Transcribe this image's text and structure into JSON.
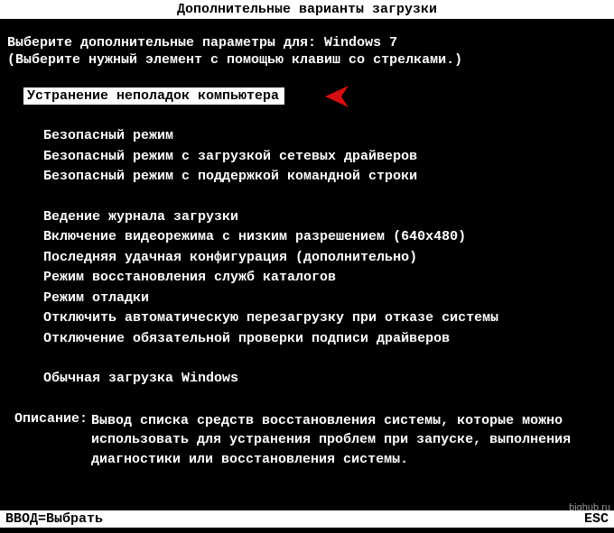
{
  "title": "Дополнительные варианты загрузки",
  "prompt": "Выберите дополнительные параметры для: Windows 7",
  "hint": "(Выберите нужный элемент с помощью клавиш со стрелками.)",
  "selected_option": "Устранение неполадок компьютера",
  "groups": [
    [
      "Безопасный режим",
      "Безопасный режим с загрузкой сетевых драйверов",
      "Безопасный режим с поддержкой командной строки"
    ],
    [
      "Ведение журнала загрузки",
      "Включение видеорежима с низким разрешением (640x480)",
      "Последняя удачная конфигурация (дополнительно)",
      "Режим восстановления служб каталогов",
      "Режим отладки",
      "Отключить автоматическую перезагрузку при отказе системы",
      "Отключение обязательной проверки подписи драйверов"
    ],
    [
      "Обычная загрузка Windows"
    ]
  ],
  "description": {
    "label": "Описание:",
    "text": "Вывод списка средств восстановления системы, которые можно использовать для устранения проблем при запуске, выполнения диагностики или восстановления системы."
  },
  "footer": {
    "left": "ВВОД=Выбрать",
    "right": "ESC"
  },
  "watermark": "bighub.ru",
  "colors": {
    "arrow": "#d40f0f"
  }
}
